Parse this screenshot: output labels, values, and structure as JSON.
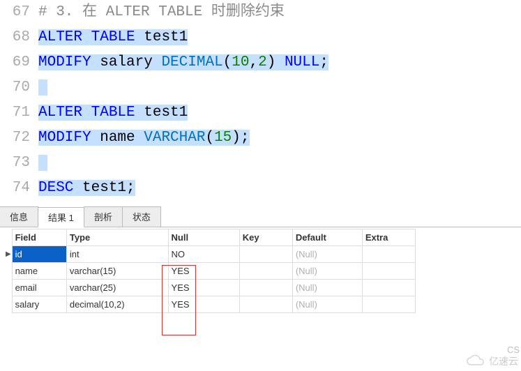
{
  "code": {
    "lines": [
      {
        "n": "67",
        "tokens": [
          {
            "t": "# 3. 在 ALTER TABLE 时删除约束",
            "cls": "comment",
            "sel": false
          }
        ]
      },
      {
        "n": "68",
        "tokens": [
          {
            "t": "ALTER",
            "cls": "kw-blue",
            "sel": true
          },
          {
            "t": " ",
            "cls": "plain",
            "sel": true
          },
          {
            "t": "TABLE",
            "cls": "kw-blue",
            "sel": true
          },
          {
            "t": " test1",
            "cls": "plain",
            "sel": true
          }
        ]
      },
      {
        "n": "69",
        "tokens": [
          {
            "t": "MODIFY",
            "cls": "kw-blue",
            "sel": true
          },
          {
            "t": " salary ",
            "cls": "plain",
            "sel": true
          },
          {
            "t": "DECIMAL",
            "cls": "type",
            "sel": true
          },
          {
            "t": "(",
            "cls": "plain",
            "sel": true
          },
          {
            "t": "10",
            "cls": "num",
            "sel": true
          },
          {
            "t": ",",
            "cls": "plain",
            "sel": true
          },
          {
            "t": "2",
            "cls": "num",
            "sel": true
          },
          {
            "t": ") ",
            "cls": "plain",
            "sel": true
          },
          {
            "t": "NULL",
            "cls": "kw-blue",
            "sel": true
          },
          {
            "t": ";",
            "cls": "plain",
            "sel": true
          }
        ]
      },
      {
        "n": "70",
        "tokens": [
          {
            "t": " ",
            "cls": "plain",
            "sel": true
          }
        ]
      },
      {
        "n": "71",
        "tokens": [
          {
            "t": "ALTER",
            "cls": "kw-blue",
            "sel": true
          },
          {
            "t": " ",
            "cls": "plain",
            "sel": true
          },
          {
            "t": "TABLE",
            "cls": "kw-blue",
            "sel": true
          },
          {
            "t": " test1",
            "cls": "plain",
            "sel": true
          }
        ]
      },
      {
        "n": "72",
        "tokens": [
          {
            "t": "MODIFY",
            "cls": "kw-blue",
            "sel": true
          },
          {
            "t": " name ",
            "cls": "plain",
            "sel": true
          },
          {
            "t": "VARCHAR",
            "cls": "type",
            "sel": true
          },
          {
            "t": "(",
            "cls": "plain",
            "sel": true
          },
          {
            "t": "15",
            "cls": "num",
            "sel": true
          },
          {
            "t": ");",
            "cls": "plain",
            "sel": true
          }
        ]
      },
      {
        "n": "73",
        "tokens": [
          {
            "t": " ",
            "cls": "plain",
            "sel": true
          }
        ]
      },
      {
        "n": "74",
        "tokens": [
          {
            "t": "DESC",
            "cls": "kw-blue",
            "sel": true
          },
          {
            "t": " test1;",
            "cls": "plain",
            "sel": true
          }
        ]
      }
    ]
  },
  "tabs": {
    "items": [
      {
        "label": "信息",
        "active": false
      },
      {
        "label": "结果 1",
        "active": true
      },
      {
        "label": "剖析",
        "active": false
      },
      {
        "label": "状态",
        "active": false
      }
    ]
  },
  "grid": {
    "headers": [
      "Field",
      "Type",
      "Null",
      "Key",
      "Default",
      "Extra"
    ],
    "rows": [
      {
        "ptr": "▶",
        "selected": true,
        "field": "id",
        "type": "int",
        "null": "NO",
        "key": "",
        "default": "(Null)",
        "extra": ""
      },
      {
        "ptr": "",
        "selected": false,
        "field": "name",
        "type": "varchar(15)",
        "null": "YES",
        "key": "",
        "default": "(Null)",
        "extra": ""
      },
      {
        "ptr": "",
        "selected": false,
        "field": "email",
        "type": "varchar(25)",
        "null": "YES",
        "key": "",
        "default": "(Null)",
        "extra": ""
      },
      {
        "ptr": "",
        "selected": false,
        "field": "salary",
        "type": "decimal(10,2)",
        "null": "YES",
        "key": "",
        "default": "(Null)",
        "extra": ""
      }
    ]
  },
  "misc": {
    "watermark_text": "亿速云",
    "corner_text": "CS"
  }
}
